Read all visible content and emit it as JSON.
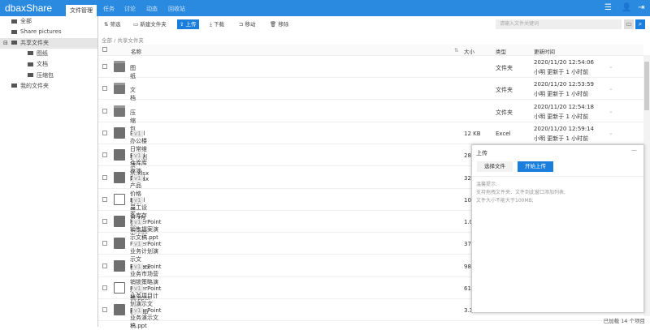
{
  "app": {
    "logo": "dbaxShare",
    "tabs": [
      "文件管理",
      "任务",
      "讨论",
      "动态",
      "回收站"
    ],
    "active_tab": 0,
    "icons": [
      "menu-icon",
      "user-icon",
      "logout-icon"
    ]
  },
  "sidebar": {
    "items": [
      {
        "label": "全部",
        "icon": "list-icon",
        "level": 0
      },
      {
        "label": "Share pictures",
        "icon": "folder-icon",
        "level": 0
      },
      {
        "label": "共享文件夹",
        "icon": "folder-icon",
        "level": 0,
        "selected": true,
        "expanded": true
      },
      {
        "label": "图纸",
        "icon": "folder-icon",
        "level": 1
      },
      {
        "label": "文档",
        "icon": "folder-icon",
        "level": 1
      },
      {
        "label": "压缩包",
        "icon": "folder-icon",
        "level": 1
      },
      {
        "label": "我的文件夹",
        "icon": "folder-icon",
        "level": 0
      }
    ]
  },
  "toolbar": {
    "filter": "筛选",
    "new_folder": "新建文件夹",
    "upload": "上传",
    "download": "下载",
    "move": "移动",
    "delete": "移除",
    "search_placeholder": "请输入文件关键词"
  },
  "breadcrumb": "全部 / 共享文件夹",
  "columns": {
    "name": "名称",
    "size": "大小",
    "type": "类型",
    "updated": "更新时间"
  },
  "rows": [
    {
      "name": "图纸",
      "kind": "folder",
      "size": "",
      "type": "文件夹",
      "time": "2020/11/20 12:54:06",
      "by": "小明 更新于 1 小时前"
    },
    {
      "name": "文档",
      "kind": "folder",
      "size": "",
      "type": "文件夹",
      "time": "2020/11/20 12:53:59",
      "by": "小明 更新于 1 小时前"
    },
    {
      "name": "压缩包",
      "kind": "folder",
      "size": "",
      "type": "文件夹",
      "time": "2020/11/20 12:54:18",
      "by": "小明 更新于 1 小时前"
    },
    {
      "name": "Excel办公楼日常维护计划演示.xlsx",
      "kind": "xls",
      "ver": "v1",
      "size": "12 KB",
      "type": "Excel",
      "time": "2020/11/20 12:59:14",
      "by": "小明 更新于 1 小时前"
    },
    {
      "name": "Excel仓库库存演示.xlsx",
      "kind": "xls",
      "ver": "v1",
      "size": "28"
    },
    {
      "name": "Excel产品价格列表演示.xls",
      "kind": "xls",
      "ver": "v1",
      "size": "32"
    },
    {
      "name": "Excel员工设备库存演示.ods",
      "kind": "doc",
      "ver": "v1",
      "size": "10"
    },
    {
      "name": "PowerPoint销售提案演示文稿.ppt",
      "kind": "ppt",
      "ver": "v1",
      "size": "1.0"
    },
    {
      "name": "PowerPoint业务计划演示文稿.pptx",
      "kind": "ppt",
      "ver": "v1",
      "size": "37"
    },
    {
      "name": "PowerPoint业务市场营销锁策略演示文稿.pptx",
      "kind": "ppt",
      "ver": "v1",
      "size": "98"
    },
    {
      "name": "PowerPoint业务项目计划演示文稿.odp",
      "kind": "doc",
      "ver": "v1",
      "size": "61"
    },
    {
      "name": "PowerPoint业务演示文稿.ppt",
      "kind": "ppt",
      "ver": "v1",
      "size": "3.3"
    }
  ],
  "footer": "已加载 14 个项目",
  "upload_panel": {
    "title": "上传",
    "choose": "选择文件",
    "start": "开始上传",
    "tips": [
      "温馨提示:",
      "支持拖拽文件夹、文件到此窗口添加列表;",
      "文件大小不能大于100MB;"
    ]
  },
  "colors": {
    "brand": "#2a8ae0",
    "primary_button": "#1a7fdc"
  }
}
